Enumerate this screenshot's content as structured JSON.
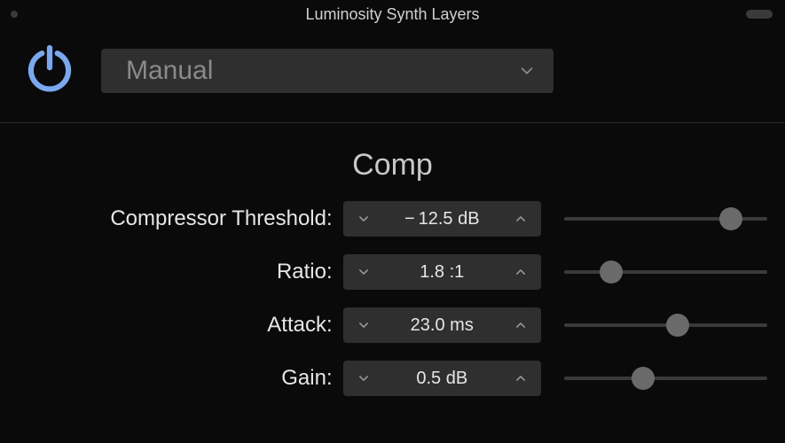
{
  "titlebar": {
    "title": "Luminosity Synth Layers"
  },
  "header": {
    "preset_label": "Manual"
  },
  "section": {
    "title": "Comp"
  },
  "colors": {
    "accent": "#7aa8f0"
  },
  "params": [
    {
      "label": "Compressor Threshold:",
      "value": "− 12.5 dB",
      "slider_pct": 82
    },
    {
      "label": "Ratio:",
      "value": "1.8 :1",
      "slider_pct": 23
    },
    {
      "label": "Attack:",
      "value": "23.0 ms",
      "slider_pct": 56
    },
    {
      "label": "Gain:",
      "value": "0.5 dB",
      "slider_pct": 39
    }
  ]
}
